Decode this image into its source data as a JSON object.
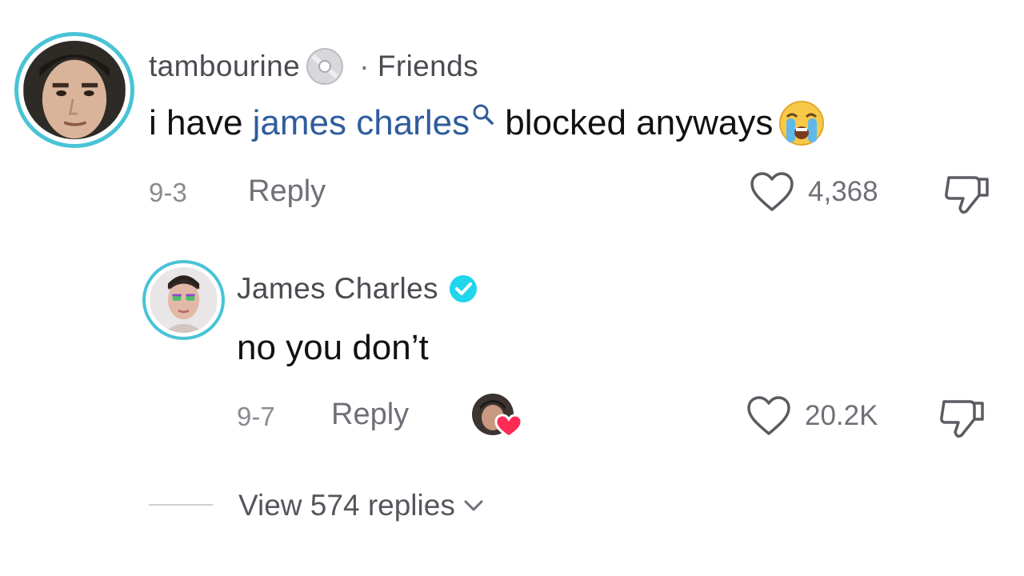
{
  "comment": {
    "username": "tambourine",
    "separator": "·",
    "tag": "Friends",
    "text_before": "i have ",
    "mention": "james charles",
    "text_after": " blocked anyways",
    "date": "9-3",
    "reply_label": "Reply",
    "like_count": "4,368",
    "icons": [
      "disc-icon",
      "search-icon",
      "crying-emoji-icon",
      "heart-icon",
      "dislike-icon"
    ]
  },
  "reply": {
    "username": "James Charles",
    "verified": true,
    "text": "no you don’t",
    "date": "9-7",
    "reply_label": "Reply",
    "like_count": "20.2K",
    "icons": [
      "verified-badge-icon",
      "creator-liked-heart-icon",
      "heart-icon",
      "dislike-icon"
    ]
  },
  "thread": {
    "view_replies_label": "View 574 replies",
    "icon": "chevron-down-icon"
  },
  "colors": {
    "avatar_ring": "#49c3d6",
    "mention": "#2f5d9c",
    "verified": "#20d5ec",
    "heart_red": "#fe2c55"
  }
}
